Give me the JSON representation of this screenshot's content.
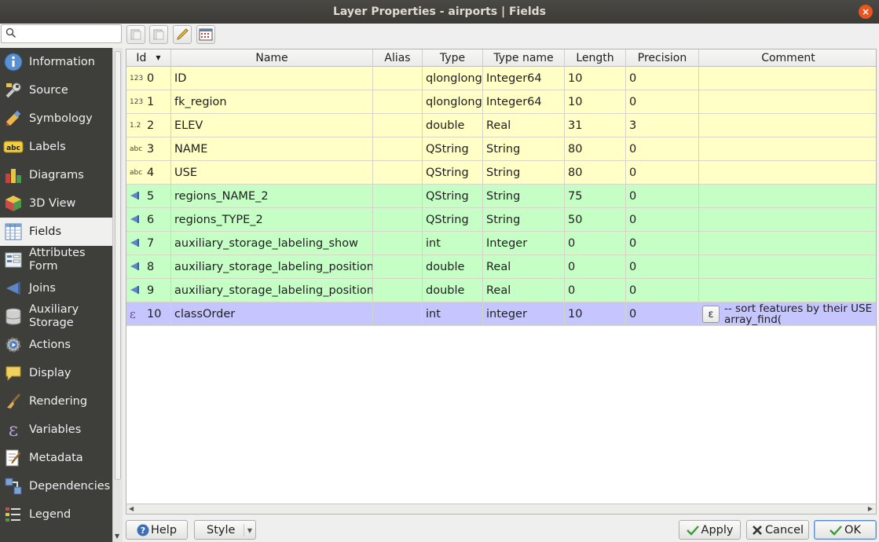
{
  "window": {
    "title": "Layer Properties - airports | Fields",
    "close_glyph": "×"
  },
  "search": {
    "placeholder": ""
  },
  "sidebar": {
    "items": [
      {
        "label": "Information",
        "icon": "info-icon"
      },
      {
        "label": "Source",
        "icon": "source-wrench-icon"
      },
      {
        "label": "Symbology",
        "icon": "symbology-brush-icon"
      },
      {
        "label": "Labels",
        "icon": "labels-abc-icon"
      },
      {
        "label": "Diagrams",
        "icon": "diagrams-icon"
      },
      {
        "label": "3D View",
        "icon": "cube-icon"
      },
      {
        "label": "Fields",
        "icon": "fields-icon",
        "active": true
      },
      {
        "label": "Attributes Form",
        "icon": "form-icon"
      },
      {
        "label": "Joins",
        "icon": "joins-icon"
      },
      {
        "label": "Auxiliary Storage",
        "icon": "database-icon"
      },
      {
        "label": "Actions",
        "icon": "actions-gear-icon"
      },
      {
        "label": "Display",
        "icon": "speech-bubble-icon"
      },
      {
        "label": "Rendering",
        "icon": "paintbrush-icon"
      },
      {
        "label": "Variables",
        "icon": "epsilon-icon"
      },
      {
        "label": "Metadata",
        "icon": "metadata-pencil-icon"
      },
      {
        "label": "Dependencies",
        "icon": "dependencies-icon"
      },
      {
        "label": "Legend",
        "icon": "legend-icon"
      }
    ]
  },
  "toolbar": {
    "buttons": [
      "new-field-icon",
      "delete-field-icon",
      "toggle-editing-icon",
      "field-calculator-icon"
    ]
  },
  "table": {
    "headers": [
      "Id",
      "Name",
      "Alias",
      "Type",
      "Type name",
      "Length",
      "Precision",
      "Comment"
    ],
    "rows": [
      {
        "kind": "yellow",
        "type_icon": "123",
        "id": "0",
        "name": "ID",
        "alias": "",
        "type": "qlonglong",
        "type_name": "Integer64",
        "length": "10",
        "precision": "0",
        "comment": ""
      },
      {
        "kind": "yellow",
        "type_icon": "123",
        "id": "1",
        "name": "fk_region",
        "alias": "",
        "type": "qlonglong",
        "type_name": "Integer64",
        "length": "10",
        "precision": "0",
        "comment": ""
      },
      {
        "kind": "yellow",
        "type_icon": "1.2",
        "id": "2",
        "name": "ELEV",
        "alias": "",
        "type": "double",
        "type_name": "Real",
        "length": "31",
        "precision": "3",
        "comment": ""
      },
      {
        "kind": "yellow",
        "type_icon": "abc",
        "id": "3",
        "name": "NAME",
        "alias": "",
        "type": "QString",
        "type_name": "String",
        "length": "80",
        "precision": "0",
        "comment": ""
      },
      {
        "kind": "yellow",
        "type_icon": "abc",
        "id": "4",
        "name": "USE",
        "alias": "",
        "type": "QString",
        "type_name": "String",
        "length": "80",
        "precision": "0",
        "comment": ""
      },
      {
        "kind": "green",
        "type_icon": "join",
        "id": "5",
        "name": "regions_NAME_2",
        "alias": "",
        "type": "QString",
        "type_name": "String",
        "length": "75",
        "precision": "0",
        "comment": ""
      },
      {
        "kind": "green",
        "type_icon": "join",
        "id": "6",
        "name": "regions_TYPE_2",
        "alias": "",
        "type": "QString",
        "type_name": "String",
        "length": "50",
        "precision": "0",
        "comment": ""
      },
      {
        "kind": "green",
        "type_icon": "join",
        "id": "7",
        "name": "auxiliary_storage_labeling_show",
        "alias": "",
        "type": "int",
        "type_name": "Integer",
        "length": "0",
        "precision": "0",
        "comment": ""
      },
      {
        "kind": "green",
        "type_icon": "join",
        "id": "8",
        "name": "auxiliary_storage_labeling_positionx",
        "alias": "",
        "type": "double",
        "type_name": "Real",
        "length": "0",
        "precision": "0",
        "comment": ""
      },
      {
        "kind": "green",
        "type_icon": "join",
        "id": "9",
        "name": "auxiliary_storage_labeling_positiony",
        "alias": "",
        "type": "double",
        "type_name": "Real",
        "length": "0",
        "precision": "0",
        "comment": ""
      },
      {
        "kind": "blue",
        "type_icon": "ε",
        "id": "10",
        "name": "classOrder",
        "alias": "",
        "type": "int",
        "type_name": "integer",
        "length": "10",
        "precision": "0",
        "comment": "-- sort features by their USE a\narray_find("
      }
    ]
  },
  "buttons": {
    "help": "Help",
    "style": "Style",
    "apply": "Apply",
    "cancel": "Cancel",
    "ok": "OK"
  },
  "colors": {
    "row_provider": "#ffffc6",
    "row_joined": "#c6ffc6",
    "row_virtual": "#c6c6ff",
    "sidebar_bg": "#3e3e3b",
    "titlebar_bg": "#3b3a36"
  }
}
